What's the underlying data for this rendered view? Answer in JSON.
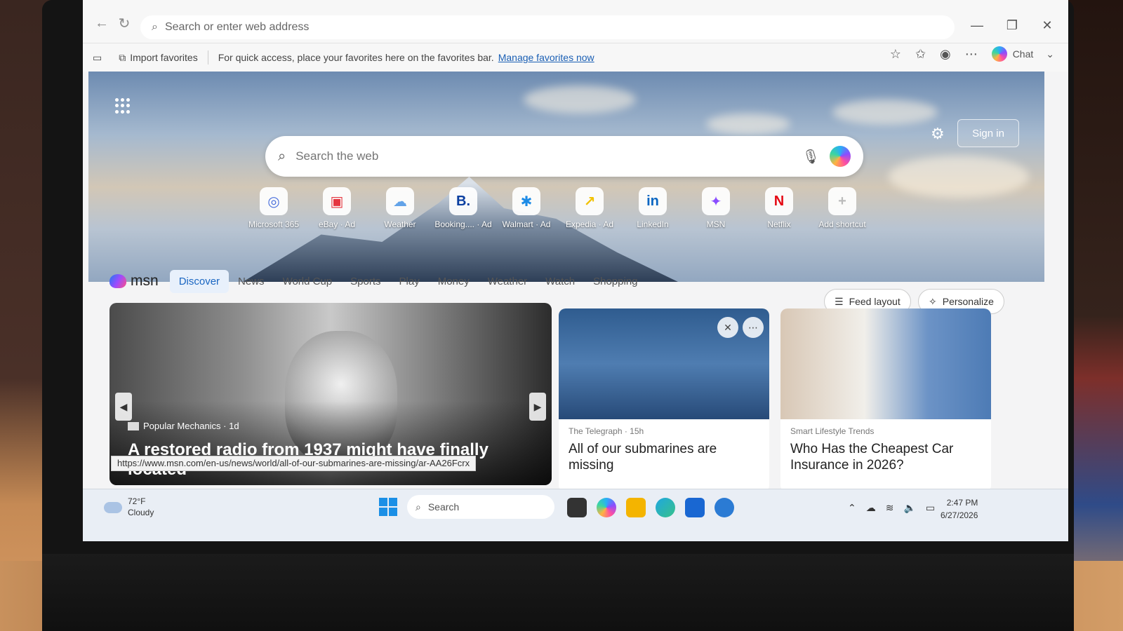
{
  "browser": {
    "address_placeholder": "Search or enter web address",
    "favorites_bar": {
      "import_label": "Import favorites",
      "hint": "For quick access, place your favorites here on the favorites bar.",
      "manage_link": "Manage favorites now"
    },
    "chat_label": "Chat"
  },
  "msn": {
    "search_placeholder": "Search the web",
    "sign_in": "Sign in",
    "shortcuts": [
      {
        "label": "Microsoft 365",
        "icon": "m365-icon",
        "glyph": "◎",
        "color": "#4a6fdc"
      },
      {
        "label": "eBay · Ad",
        "icon": "ebay-bag-icon",
        "glyph": "▣",
        "color": "#e5353f"
      },
      {
        "label": "Weather",
        "icon": "weather-icon",
        "glyph": "☁",
        "color": "#63a3e8"
      },
      {
        "label": "Booking.... · Ad",
        "icon": "booking-icon",
        "glyph": "B.",
        "color": "#0b3fa0"
      },
      {
        "label": "Walmart · Ad",
        "icon": "walmart-icon",
        "glyph": "✱",
        "color": "#1d8be6"
      },
      {
        "label": "Expedia · Ad",
        "icon": "expedia-icon",
        "glyph": "↗",
        "color": "#f2c200"
      },
      {
        "label": "LinkedIn",
        "icon": "linkedin-icon",
        "glyph": "in",
        "color": "#0a66c2"
      },
      {
        "label": "MSN",
        "icon": "msn-icon",
        "glyph": "✦",
        "color": "#8a4dff"
      },
      {
        "label": "Netflix",
        "icon": "netflix-icon",
        "glyph": "N",
        "color": "#e50914"
      },
      {
        "label": "Add shortcut",
        "icon": "plus-icon",
        "glyph": "+",
        "color": "#bbbbbb"
      }
    ],
    "logo_text": "msn",
    "tabs": [
      "Discover",
      "News",
      "World Cup",
      "Sports",
      "Play",
      "Money",
      "Weather",
      "Watch",
      "Shopping"
    ],
    "feed_layout": "Feed layout",
    "personalize": "Personalize",
    "hero_story": {
      "source": "Popular Mechanics · 1d",
      "headline": "A restored radio from 1937 might have finally located"
    },
    "card2": {
      "source": "The Telegraph · 15h",
      "title": "All of our submarines are missing"
    },
    "card3": {
      "source": "Smart Lifestyle Trends",
      "title": "Who Has the Cheapest Car Insurance in 2026?"
    },
    "status_url": "https://www.msn.com/en-us/news/world/all-of-our-submarines-are-missing/ar-AA26Fcrx"
  },
  "taskbar": {
    "weather_temp": "72°F",
    "weather_cond": "Cloudy",
    "search": "Search",
    "time": "2:47 PM",
    "date": "6/27/2026"
  },
  "colors": {
    "accent": "#1a66c2",
    "link": "#1a5fb4"
  }
}
